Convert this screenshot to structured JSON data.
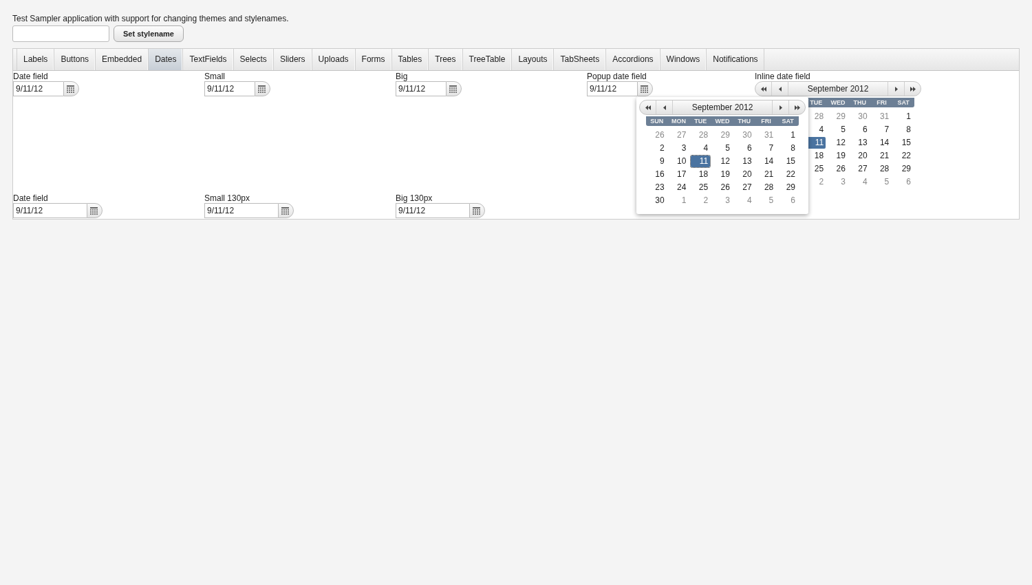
{
  "intro": "Test Sampler application with support for changing themes and stylenames.",
  "stylename": {
    "button": "Set stylename"
  },
  "tabs": [
    {
      "label": "Labels",
      "selected": false
    },
    {
      "label": "Buttons",
      "selected": false
    },
    {
      "label": "Embedded",
      "selected": false
    },
    {
      "label": "Dates",
      "selected": true
    },
    {
      "label": "TextFields",
      "selected": false
    },
    {
      "label": "Selects",
      "selected": false
    },
    {
      "label": "Sliders",
      "selected": false
    },
    {
      "label": "Uploads",
      "selected": false
    },
    {
      "label": "Forms",
      "selected": false
    },
    {
      "label": "Tables",
      "selected": false
    },
    {
      "label": "Trees",
      "selected": false
    },
    {
      "label": "TreeTable",
      "selected": false
    },
    {
      "label": "Layouts",
      "selected": false
    },
    {
      "label": "TabSheets",
      "selected": false
    },
    {
      "label": "Accordions",
      "selected": false
    },
    {
      "label": "Windows",
      "selected": false
    },
    {
      "label": "Notifications",
      "selected": false
    }
  ],
  "rows": [
    [
      {
        "kind": "date_field",
        "label": "Date field",
        "value": "9/11/12"
      },
      {
        "kind": "date_field",
        "label": "Small",
        "value": "9/11/12"
      },
      {
        "kind": "date_field",
        "label": "Big",
        "value": "9/11/12"
      },
      {
        "kind": "popup_date_field",
        "label": "Popup date field",
        "value": "9/11/12",
        "popup": {
          "month": "September 2012",
          "keyboard_focus": true,
          "weekdays": [
            "SUN",
            "MON",
            "TUE",
            "WED",
            "THU",
            "FRI",
            "SAT"
          ],
          "weeks": [
            [
              {
                "day": "26",
                "other_month": true,
                "selected": false
              },
              {
                "day": "27",
                "other_month": true,
                "selected": false
              },
              {
                "day": "28",
                "other_month": true,
                "selected": false
              },
              {
                "day": "29",
                "other_month": true,
                "selected": false
              },
              {
                "day": "30",
                "other_month": true,
                "selected": false
              },
              {
                "day": "31",
                "other_month": true,
                "selected": false
              },
              {
                "day": "1",
                "other_month": false,
                "selected": false
              }
            ],
            [
              {
                "day": "2",
                "other_month": false,
                "selected": false
              },
              {
                "day": "3",
                "other_month": false,
                "selected": false
              },
              {
                "day": "4",
                "other_month": false,
                "selected": false
              },
              {
                "day": "5",
                "other_month": false,
                "selected": false
              },
              {
                "day": "6",
                "other_month": false,
                "selected": false
              },
              {
                "day": "7",
                "other_month": false,
                "selected": false
              },
              {
                "day": "8",
                "other_month": false,
                "selected": false
              }
            ],
            [
              {
                "day": "9",
                "other_month": false,
                "selected": false
              },
              {
                "day": "10",
                "other_month": false,
                "selected": false
              },
              {
                "day": "11",
                "other_month": false,
                "selected": true
              },
              {
                "day": "12",
                "other_month": false,
                "selected": false
              },
              {
                "day": "13",
                "other_month": false,
                "selected": false
              },
              {
                "day": "14",
                "other_month": false,
                "selected": false
              },
              {
                "day": "15",
                "other_month": false,
                "selected": false
              }
            ],
            [
              {
                "day": "16",
                "other_month": false,
                "selected": false
              },
              {
                "day": "17",
                "other_month": false,
                "selected": false
              },
              {
                "day": "18",
                "other_month": false,
                "selected": false
              },
              {
                "day": "19",
                "other_month": false,
                "selected": false
              },
              {
                "day": "20",
                "other_month": false,
                "selected": false
              },
              {
                "day": "21",
                "other_month": false,
                "selected": false
              },
              {
                "day": "22",
                "other_month": false,
                "selected": false
              }
            ],
            [
              {
                "day": "23",
                "other_month": false,
                "selected": false
              },
              {
                "day": "24",
                "other_month": false,
                "selected": false
              },
              {
                "day": "25",
                "other_month": false,
                "selected": false
              },
              {
                "day": "26",
                "other_month": false,
                "selected": false
              },
              {
                "day": "27",
                "other_month": false,
                "selected": false
              },
              {
                "day": "28",
                "other_month": false,
                "selected": false
              },
              {
                "day": "29",
                "other_month": false,
                "selected": false
              }
            ],
            [
              {
                "day": "30",
                "other_month": false,
                "selected": false
              },
              {
                "day": "1",
                "other_month": true,
                "selected": false
              },
              {
                "day": "2",
                "other_month": true,
                "selected": false
              },
              {
                "day": "3",
                "other_month": true,
                "selected": false
              },
              {
                "day": "4",
                "other_month": true,
                "selected": false
              },
              {
                "day": "5",
                "other_month": true,
                "selected": false
              },
              {
                "day": "6",
                "other_month": true,
                "selected": false
              }
            ]
          ]
        }
      },
      {
        "kind": "inline_date_field",
        "label": "Inline date field",
        "calendar": {
          "month": "September 2012",
          "keyboard_focus": false,
          "weekdays": [
            "TUE",
            "WED",
            "THU",
            "FRI",
            "SAT"
          ],
          "weeks": [
            [
              {
                "day": "28",
                "other_month": true,
                "selected": false
              },
              {
                "day": "29",
                "other_month": true,
                "selected": false
              },
              {
                "day": "30",
                "other_month": true,
                "selected": false
              },
              {
                "day": "31",
                "other_month": true,
                "selected": false
              },
              {
                "day": "1",
                "other_month": false,
                "selected": false
              }
            ],
            [
              {
                "day": "4",
                "other_month": false,
                "selected": false
              },
              {
                "day": "5",
                "other_month": false,
                "selected": false
              },
              {
                "day": "6",
                "other_month": false,
                "selected": false
              },
              {
                "day": "7",
                "other_month": false,
                "selected": false
              },
              {
                "day": "8",
                "other_month": false,
                "selected": false
              }
            ],
            [
              {
                "day": "11",
                "other_month": false,
                "selected": true
              },
              {
                "day": "12",
                "other_month": false,
                "selected": false
              },
              {
                "day": "13",
                "other_month": false,
                "selected": false
              },
              {
                "day": "14",
                "other_month": false,
                "selected": false
              },
              {
                "day": "15",
                "other_month": false,
                "selected": false
              }
            ],
            [
              {
                "day": "18",
                "other_month": false,
                "selected": false
              },
              {
                "day": "19",
                "other_month": false,
                "selected": false
              },
              {
                "day": "20",
                "other_month": false,
                "selected": false
              },
              {
                "day": "21",
                "other_month": false,
                "selected": false
              },
              {
                "day": "22",
                "other_month": false,
                "selected": false
              }
            ],
            [
              {
                "day": "25",
                "other_month": false,
                "selected": false
              },
              {
                "day": "26",
                "other_month": false,
                "selected": false
              },
              {
                "day": "27",
                "other_month": false,
                "selected": false
              },
              {
                "day": "28",
                "other_month": false,
                "selected": false
              },
              {
                "day": "29",
                "other_month": false,
                "selected": false
              }
            ],
            [
              {
                "day": "2",
                "other_month": true,
                "selected": false
              },
              {
                "day": "3",
                "other_month": true,
                "selected": false
              },
              {
                "day": "4",
                "other_month": true,
                "selected": false
              },
              {
                "day": "5",
                "other_month": true,
                "selected": false
              },
              {
                "day": "6",
                "other_month": true,
                "selected": false
              }
            ]
          ]
        }
      }
    ],
    [
      {
        "kind": "wide_date_field",
        "label": "Date field",
        "value": "9/11/12"
      },
      {
        "kind": "wide_date_field",
        "label": "Small 130px",
        "value": "9/11/12"
      },
      {
        "kind": "wide_date_field",
        "label": "Big 130px",
        "value": "9/11/12"
      }
    ]
  ]
}
